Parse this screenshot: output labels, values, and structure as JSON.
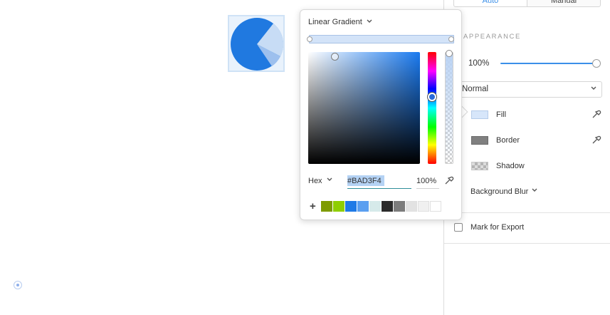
{
  "canvas": {
    "pie": {
      "base_color": "#2079e0",
      "light_color": "#c7dcf5",
      "mid_color": "#9dc0ee"
    }
  },
  "panel": {
    "segment": {
      "auto_label": "Auto",
      "manual_label": "Manual"
    },
    "appearance_header": "APPEARANCE",
    "opacity": "100%",
    "blend_mode": "Normal",
    "fill_label": "Fill",
    "border_label": "Border",
    "shadow_label": "Shadow",
    "background_blur_label": "Background Blur",
    "mark_for_export_label": "Mark for Export"
  },
  "picker": {
    "gradient_type": "Linear Gradient",
    "mode": "Hex",
    "hex_value": "#BAD3F4",
    "opacity": "100%",
    "swatches": [
      "#7e9b00",
      "#8fce00",
      "#1f7ae6",
      "#5b9ff0",
      "#d6eaea",
      "#2b2b2b",
      "#7c7c7c",
      "#e2e2e2",
      "#f0f0f0",
      "#ffffff"
    ]
  },
  "icons": {
    "chevron": "⌄",
    "eyedropper": "eyedropper-icon",
    "add": "+"
  }
}
